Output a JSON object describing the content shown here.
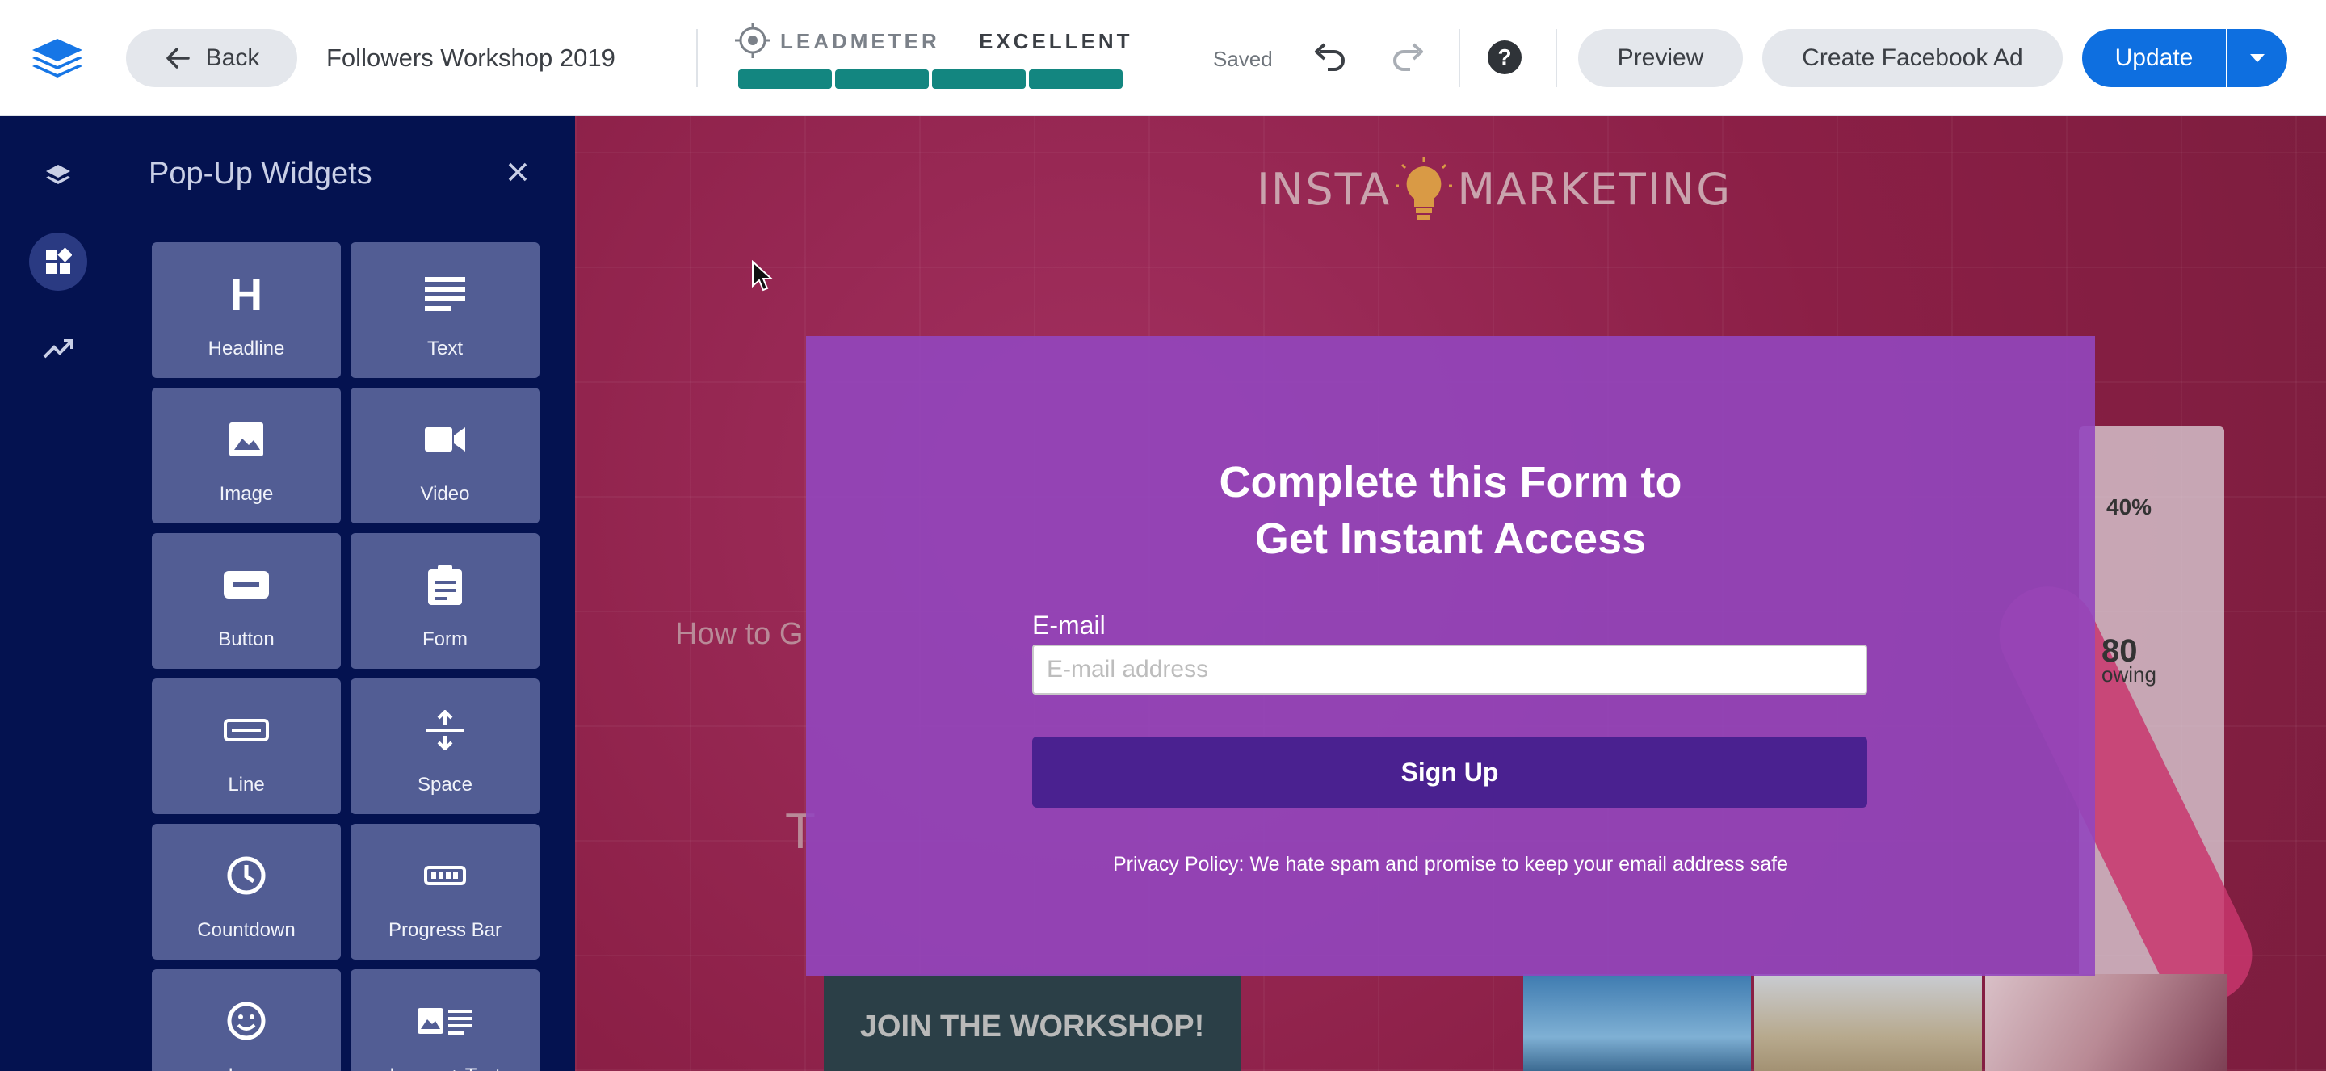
{
  "topbar": {
    "back_label": "Back",
    "page_name": "Followers Workshop 2019",
    "leadmeter_label": "LEADMETER",
    "leadmeter_rating": "EXCELLENT",
    "leadmeter_segments_filled": 4,
    "saved_label": "Saved",
    "help_label": "?",
    "preview_label": "Preview",
    "facebook_ad_label": "Create Facebook Ad",
    "update_label": "Update",
    "accent_color": "#0e6fe0",
    "leadmeter_color": "#138680"
  },
  "rail": {
    "icons": [
      "layers-icon",
      "widgets-icon",
      "trend-icon"
    ],
    "active": "widgets-icon"
  },
  "panel": {
    "title": "Pop-Up Widgets",
    "widgets": [
      {
        "label": "Headline",
        "icon": "headline-icon"
      },
      {
        "label": "Text",
        "icon": "text-icon"
      },
      {
        "label": "Image",
        "icon": "image-icon"
      },
      {
        "label": "Video",
        "icon": "video-icon"
      },
      {
        "label": "Button",
        "icon": "button-icon"
      },
      {
        "label": "Form",
        "icon": "form-icon"
      },
      {
        "label": "Line",
        "icon": "line-icon"
      },
      {
        "label": "Space",
        "icon": "space-icon"
      },
      {
        "label": "Countdown",
        "icon": "clock-icon"
      },
      {
        "label": "Progress Bar",
        "icon": "progress-bar-icon"
      },
      {
        "label": "Icon",
        "icon": "smiley-icon"
      },
      {
        "label": "Image + Text",
        "icon": "image-text-icon"
      }
    ]
  },
  "canvas": {
    "logo_left": "INSTA",
    "logo_right": "MARKETING",
    "bg_heading": "How to G",
    "bg_letter": "T",
    "phone_battery": "40%",
    "phone_stat": "80",
    "phone_stat_label": "owing",
    "join_label": "JOIN THE WORKSHOP!"
  },
  "popup": {
    "title_line1": "Complete this Form to",
    "title_line2": "Get Instant Access",
    "email_label": "E-mail",
    "email_placeholder": "E-mail address",
    "email_value": "",
    "signup_label": "Sign Up",
    "privacy": "Privacy Policy: We hate spam and promise to keep your email address safe",
    "bg_color": "#9246be",
    "button_color": "#4a2190"
  }
}
